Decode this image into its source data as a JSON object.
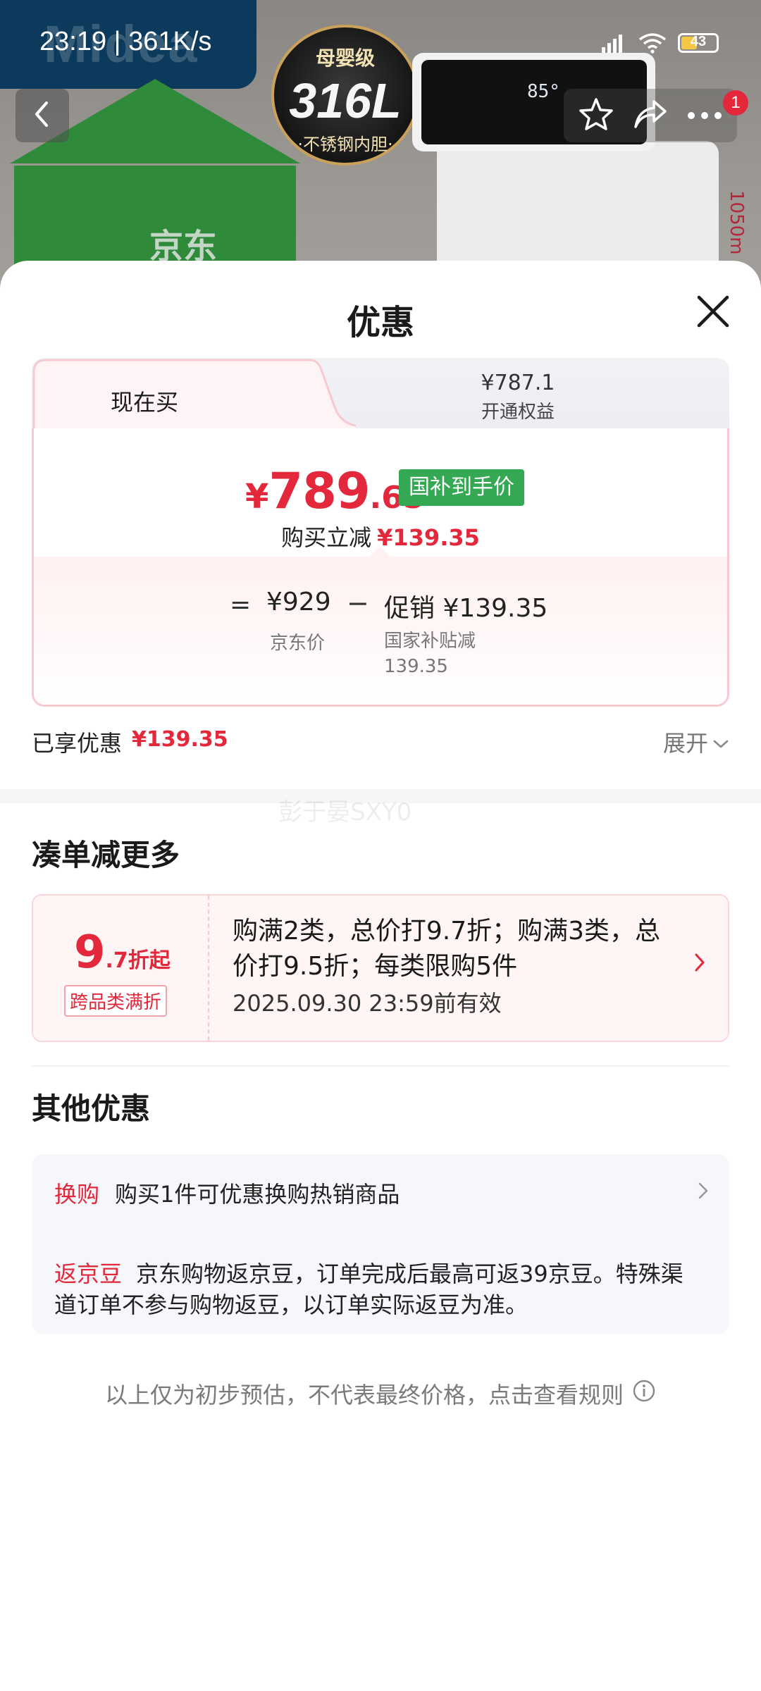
{
  "status_bar": {
    "time_speed": "23:19 | 361K/s",
    "battery": "43"
  },
  "background": {
    "brand": "Midea",
    "badge_top": "母婴级",
    "badge_main": "316L",
    "badge_bottom": "·不锈钢内胆·",
    "device_display": "85°",
    "store_text": "京东",
    "side_label": "1050m"
  },
  "nav": {
    "cart_count": "1"
  },
  "sheet": {
    "title": "优惠"
  },
  "tabs": {
    "buy_now_label": "现在买",
    "member_price": "¥787.1",
    "member_label": "开通权益"
  },
  "price_card": {
    "currency": "¥",
    "price_int": "789",
    "price_dec": ".65",
    "badge": "国补到手价",
    "instant_label": "购买立减",
    "instant_amount": "¥139.35",
    "eq": "=",
    "jd_price": "¥929",
    "jd_label": "京东价",
    "minus": "−",
    "promo": "促销 ¥139.35",
    "promo_sub1": "国家补贴减",
    "promo_sub2": "139.35"
  },
  "enjoyed": {
    "label": "已享优惠",
    "amount": "¥139.35",
    "expand": "展开"
  },
  "watermark": "彭于晏SXY0",
  "section_more": {
    "title": "凑单减更多",
    "coupon_big": "9",
    "coupon_small": ".7折起",
    "coupon_tag": "跨品类满折",
    "coupon_desc": "购满2类，总价打9.7折；购满3类，总价打9.5折；每类限购5件",
    "coupon_validity": "2025.09.30 23:59前有效"
  },
  "section_other": {
    "title": "其他优惠",
    "row1_key": "换购",
    "row1_value": "购买1件可优惠换购热销商品",
    "row2_key": "返京豆",
    "row2_value": "京东购物返京豆，订单完成后最高可返39京豆。特殊渠道订单不参与购物返豆，以订单实际返豆为准。"
  },
  "disclaimer": "以上仅为初步预估，不代表最终价格，点击查看规则",
  "colors": {
    "accent_red": "#e4283b",
    "badge_green": "#34a853"
  }
}
